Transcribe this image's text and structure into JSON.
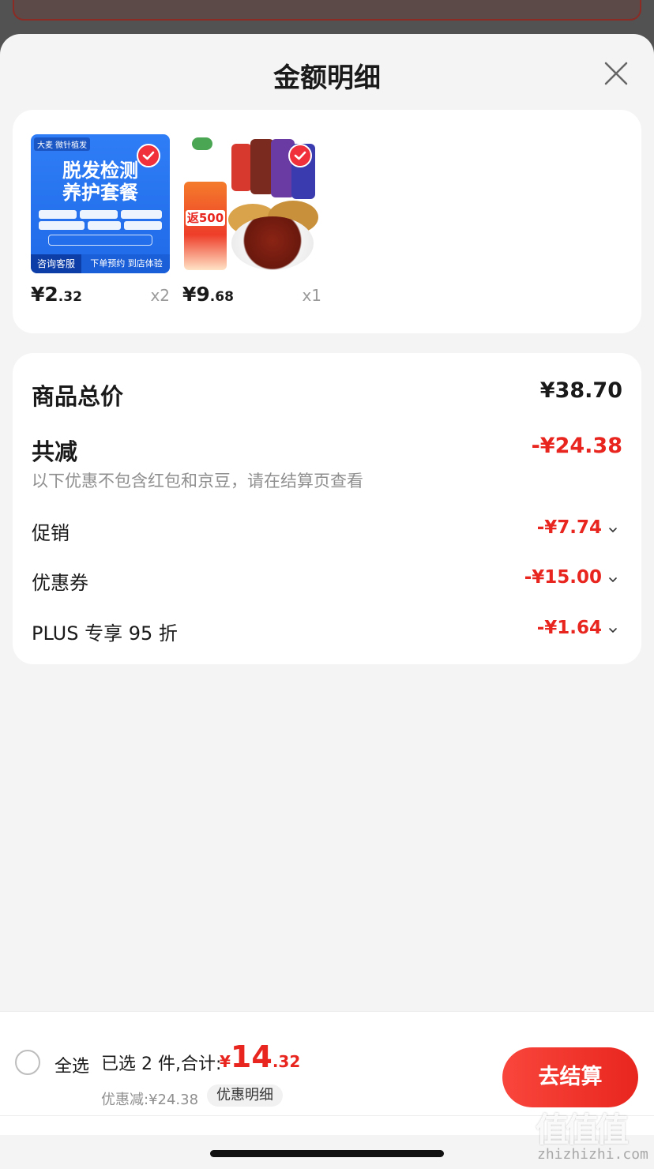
{
  "sheet": {
    "title": "金额明细"
  },
  "products": [
    {
      "price_int": "¥2",
      "price_dec": ".32",
      "qty": "x2",
      "image": {
        "tag": "大麦 微针植发",
        "headline_1": "脱发检测",
        "headline_2": "养护套餐",
        "bottom_left": "咨询客服",
        "bottom_right": "下单预约  到店体验"
      }
    },
    {
      "price_int": "¥9",
      "price_dec": ".68",
      "qty": "x1",
      "image": {
        "ribbon": "返500"
      }
    }
  ],
  "summary": {
    "total_label": "商品总价",
    "total_value": "¥38.70",
    "reduce_label": "共减",
    "reduce_value": "-¥24.38",
    "note": "以下优惠不包含红包和京豆，请在结算页查看",
    "details": [
      {
        "label": "促销",
        "value": "-¥7.74"
      },
      {
        "label": "优惠券",
        "value": "-¥15.00"
      },
      {
        "label": "PLUS 专享 95 折",
        "value": "-¥1.64"
      }
    ]
  },
  "bottom_bar": {
    "select_all": "全选",
    "summary_text": "已选 2 件,合计:",
    "amount_currency": "¥",
    "amount_int": "14",
    "amount_dec": ".32",
    "discount_text": "优惠减:¥24.38",
    "discount_detail_btn": "优惠明细",
    "checkout_btn": "去结算"
  },
  "watermark": {
    "glyphs": "值值值",
    "text": "zhizhizhi.com"
  },
  "colors": {
    "accent_red": "#e8261f",
    "sheet_bg": "#f4f4f4",
    "card_bg": "#ffffff"
  },
  "icons": [
    "close-icon",
    "check-icon",
    "chevron-down-icon",
    "radio-icon"
  ]
}
